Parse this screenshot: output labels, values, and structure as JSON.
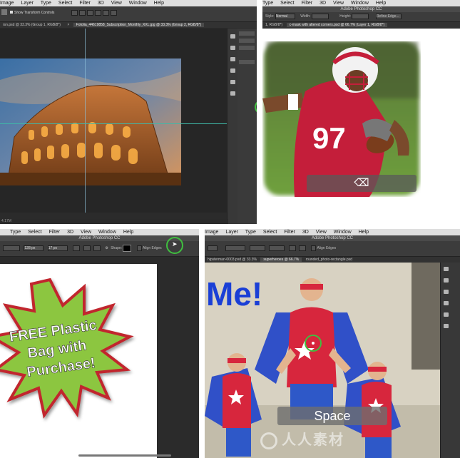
{
  "panel1": {
    "menu": [
      "Image",
      "Layer",
      "Type",
      "Select",
      "Filter",
      "3D",
      "View",
      "Window",
      "Help"
    ],
    "option_label": "Show Transform Controls",
    "tab_1": "rsn.psd @ 33.3% (Group 1, RGB/8*)",
    "tab_2": "Fotolia_44619858_Subscription_Monthly_XXL.jpg @ 33.3% (Group 2, RGB/8*)",
    "tab_close": "×",
    "status": "4.17M"
  },
  "panel2": {
    "menu": [
      "Type",
      "Select",
      "Filter",
      "3D",
      "View",
      "Window",
      "Help"
    ],
    "title": "Adobe Photoshop CC",
    "style_label": "Style:",
    "style_value": "Normal",
    "width_label": "Width:",
    "height_label": "Height:",
    "refine_label": "Refine Edge...",
    "tab_left": "1, RGB/8*)",
    "tab_right": "c-mask with altered corners.psd @ 66.7% (Layer 1, RGB/8*)",
    "jersey_number": "97",
    "key_label": "⌫"
  },
  "panel3": {
    "menu": [
      "Type",
      "Select",
      "Filter",
      "3D",
      "View",
      "Window",
      "Help"
    ],
    "title": "Adobe Photoshop CC",
    "size_1": "128 px",
    "size_2": "17 px",
    "shape_label": "Shape:",
    "align_label": "Align Edges",
    "badge_lines": [
      "FREE Plastic",
      "Bag with",
      "Purchase!"
    ]
  },
  "panel4": {
    "menu": [
      "Image",
      "Layer",
      "Type",
      "Select",
      "Filter",
      "3D",
      "View",
      "Window",
      "Help"
    ],
    "title": "Adobe Photoshop CC",
    "option_label": "Align Edges",
    "tab_1": "hipsterman-0003.psd @ 33.3%",
    "tab_2": "superheroes @ 66.7%",
    "tab_3": "rounded_photo-rectangle.psd",
    "headline": "Me!",
    "key_label": "Space",
    "watermark": "人人素材"
  },
  "colors": {
    "ps_dark": "#2b2b2b",
    "badge_green": "#8cc63f",
    "badge_border": "#c1272d",
    "jersey_red": "#c41e3a",
    "hero_red": "#d7263d",
    "hero_blue": "#3050c8",
    "headline_blue": "#1a3fd6",
    "highlight_green": "#3fbf3f"
  }
}
